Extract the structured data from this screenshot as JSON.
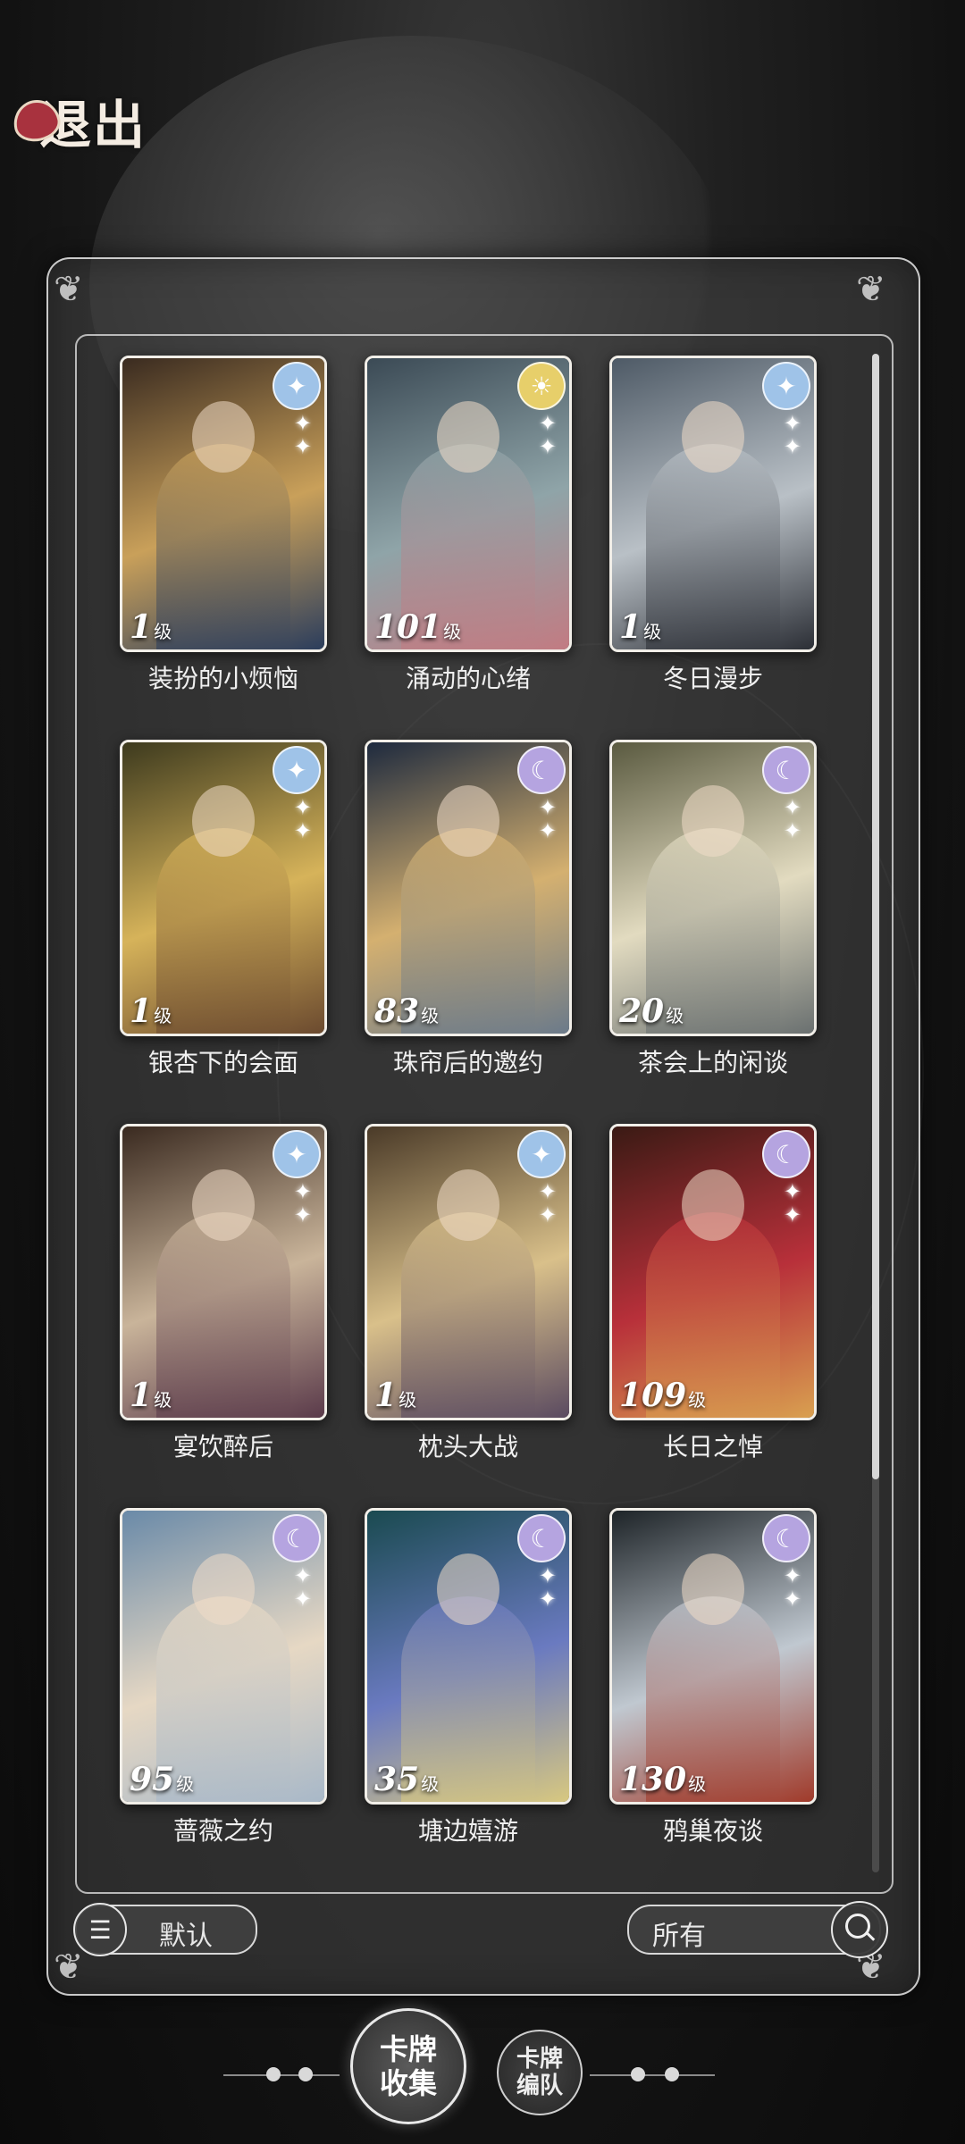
{
  "header": {
    "exit_label": "退出"
  },
  "cards": [
    {
      "title": "装扮的小烦恼",
      "level": "1",
      "unit": "级",
      "rank_icon": "star-icon",
      "badge_color": "#9fc3e8",
      "art": [
        "#3a2b20",
        "#c9a05a",
        "#2b3d5c"
      ]
    },
    {
      "title": "涌动的心绪",
      "level": "101",
      "unit": "级",
      "rank_icon": "sun-icon",
      "badge_color": "#e7cf6a",
      "art": [
        "#3b4a55",
        "#8fa4a8",
        "#c27b82"
      ]
    },
    {
      "title": "冬日漫步",
      "level": "1",
      "unit": "级",
      "rank_icon": "star-icon",
      "badge_color": "#9fc3e8",
      "art": [
        "#4e5a66",
        "#b9c0c6",
        "#2c2f36"
      ]
    },
    {
      "title": "银杏下的会面",
      "level": "1",
      "unit": "级",
      "rank_icon": "star-icon",
      "badge_color": "#9fc3e8",
      "art": [
        "#3d3a1e",
        "#d6b35a",
        "#6b4a2f"
      ]
    },
    {
      "title": "珠帘后的邀约",
      "level": "83",
      "unit": "级",
      "rank_icon": "moon-icon",
      "badge_color": "#b5a4e0",
      "art": [
        "#1e2a3e",
        "#d4b070",
        "#6b7a8a"
      ]
    },
    {
      "title": "茶会上的闲谈",
      "level": "20",
      "unit": "级",
      "rank_icon": "moon-icon",
      "badge_color": "#b5a4e0",
      "art": [
        "#5a5a40",
        "#e2dbc0",
        "#6a7070"
      ]
    },
    {
      "title": "宴饮醉后",
      "level": "1",
      "unit": "级",
      "rank_icon": "star-icon",
      "badge_color": "#9fc3e8",
      "art": [
        "#3a2a20",
        "#c9b49a",
        "#5a3a4a"
      ]
    },
    {
      "title": "枕头大战",
      "level": "1",
      "unit": "级",
      "rank_icon": "star-icon",
      "badge_color": "#9fc3e8",
      "art": [
        "#4a3a28",
        "#d9c08a",
        "#5a4a60"
      ]
    },
    {
      "title": "长日之悼",
      "level": "109",
      "unit": "级",
      "rank_icon": "moon-icon",
      "badge_color": "#b5a4e0",
      "art": [
        "#3a1a14",
        "#b8303a",
        "#d9a050"
      ]
    },
    {
      "title": "蔷薇之约",
      "level": "95",
      "unit": "级",
      "rank_icon": "moon-icon",
      "badge_color": "#b5a4e0",
      "art": [
        "#6a8aa8",
        "#e6d8c4",
        "#a8b8c8"
      ]
    },
    {
      "title": "塘边嬉游",
      "level": "35",
      "unit": "级",
      "rank_icon": "moon-icon",
      "badge_color": "#b5a4e0",
      "art": [
        "#1a4a50",
        "#6a7ac0",
        "#d8c880"
      ]
    },
    {
      "title": "鸦巢夜谈",
      "level": "130",
      "unit": "级",
      "rank_icon": "moon-icon",
      "badge_color": "#b5a4e0",
      "art": [
        "#1e2428",
        "#c0c8d0",
        "#a03a2a"
      ]
    }
  ],
  "controls": {
    "sort_label": "默认",
    "filter_label": "所有"
  },
  "nav": {
    "collection_label": "卡牌收集",
    "team_label": "卡牌编队"
  },
  "colors": {
    "panel_border": "#e6e6e6",
    "accent": "#f1eee8"
  }
}
